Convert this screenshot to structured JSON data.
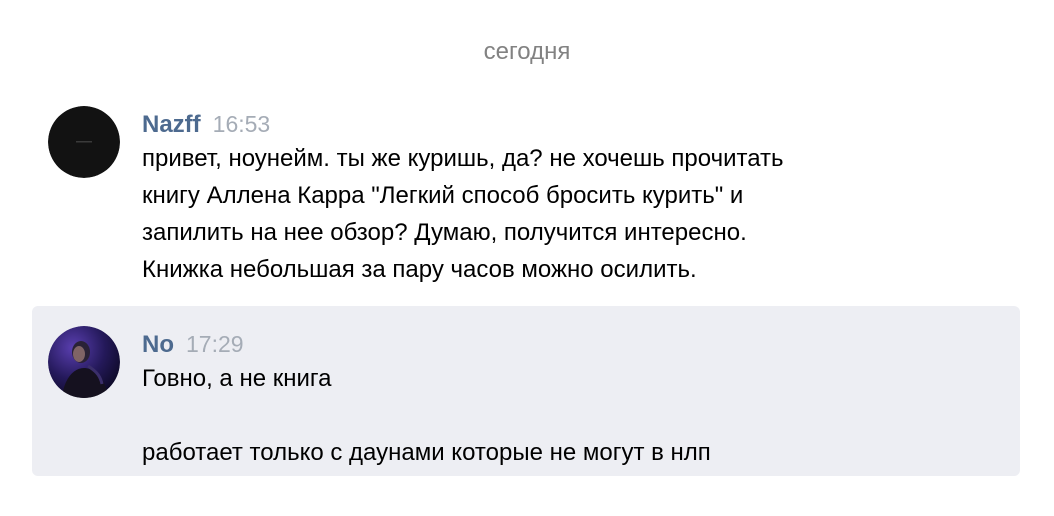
{
  "date_divider": "сегодня",
  "messages": [
    {
      "author": "Nazff",
      "time": "16:53",
      "lines": [
        "привет, ноунейм. ты же куришь, да? не хочешь прочитать",
        "книгу Аллена Карра \"Легкий способ бросить курить\" и",
        "запилить на нее обзор? Думаю, получится интересно.",
        "Книжка небольшая за пару часов можно осилить."
      ],
      "avatar": "dark-circle-avatar"
    },
    {
      "author": "No",
      "time": "17:29",
      "lines": [
        "Говно, а не книга",
        "работает только с даунами которые не могут в нлп"
      ],
      "avatar": "person-photo-avatar",
      "highlighted": true
    }
  ],
  "colors": {
    "author": "#4d6a8f",
    "time": "#a5acb6",
    "date": "#828282",
    "highlight_bg": "#edeef3"
  }
}
